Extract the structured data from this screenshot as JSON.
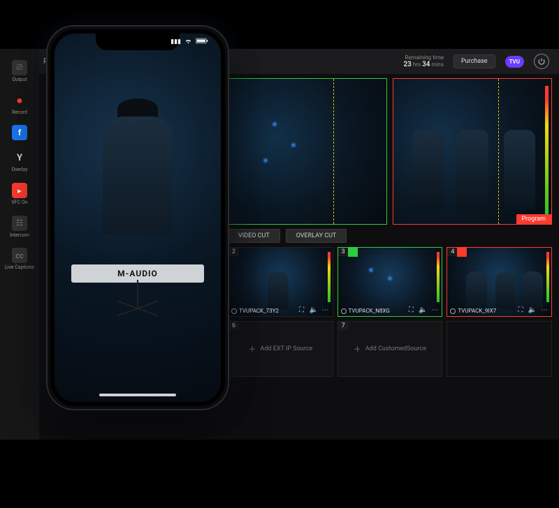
{
  "app": {
    "program_label": "Progr...",
    "remaining_caption": "Remaining time",
    "remaining_value_hrs": "23",
    "remaining_unit_hrs": "hrs",
    "remaining_value_mins": "34",
    "remaining_unit_mins": "mins",
    "purchase_label": "Purchase",
    "brand_badge": "TVU"
  },
  "rail": {
    "output": "Output",
    "record": "Record",
    "overlay": "Overlay",
    "vfc": "VFC On",
    "intercom": "Intercom",
    "captions": "Live\nCaptions",
    "y_label": "Y"
  },
  "controls": {
    "video_cut": "VIDEO CUT",
    "overlay_cut": "OVERLAY CUT",
    "program_tag": "Program"
  },
  "sources": {
    "s2": {
      "num": "2",
      "name": "TVUPACK_73Y2"
    },
    "s3": {
      "num": "3",
      "name": "TVUPACK_N8XG"
    },
    "s4": {
      "num": "4",
      "name": "TVUPACK_9IX7"
    },
    "s6": {
      "num": "6",
      "label": "Add EXT IP Source"
    },
    "s7": {
      "num": "7",
      "label": "Add CustomedSource"
    }
  },
  "phone": {
    "keyboard_brand": "M-AUDIO"
  }
}
